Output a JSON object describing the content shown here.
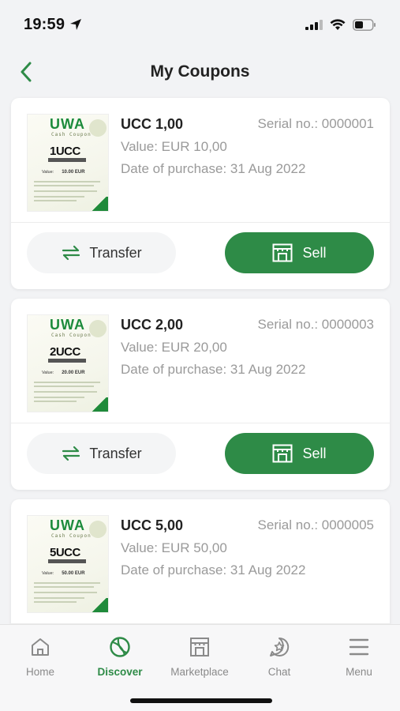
{
  "status": {
    "time": "19:59"
  },
  "header": {
    "title": "My Coupons"
  },
  "coupons": [
    {
      "title": "UCC 1,00",
      "serial": "Serial no.: 0000001",
      "value": "Value: EUR 10,00",
      "date": "Date of purchase: 31 Aug 2022",
      "thumb_amount": "1UCC",
      "thumb_value": "10.00 EUR"
    },
    {
      "title": "UCC 2,00",
      "serial": "Serial no.: 0000003",
      "value": "Value: EUR 20,00",
      "date": "Date of purchase: 31 Aug 2022",
      "thumb_amount": "2UCC",
      "thumb_value": "20.00 EUR"
    },
    {
      "title": "UCC 5,00",
      "serial": "Serial no.: 0000005",
      "value": "Value: EUR 50,00",
      "date": "Date of purchase: 31 Aug 2022",
      "thumb_amount": "5UCC",
      "thumb_value": "50.00 EUR"
    }
  ],
  "thumb": {
    "brand": "UWA",
    "brand_sub": "Cash Coupon",
    "value_label": "Value:"
  },
  "actions": {
    "transfer_label": "Transfer",
    "sell_label": "Sell"
  },
  "tabs": [
    {
      "label": "Home",
      "icon": "house-icon"
    },
    {
      "label": "Discover",
      "icon": "ball-icon"
    },
    {
      "label": "Marketplace",
      "icon": "store-icon"
    },
    {
      "label": "Chat",
      "icon": "chat-star-icon"
    },
    {
      "label": "Menu",
      "icon": "hamburger-icon"
    }
  ],
  "colors": {
    "accent": "#2e8b47",
    "background": "#f2f3f5"
  }
}
